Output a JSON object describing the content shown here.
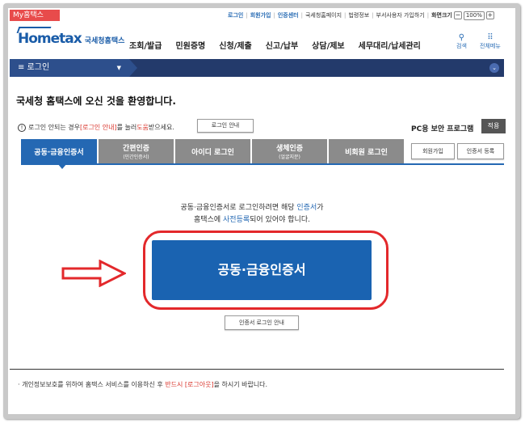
{
  "top": {
    "my_hometax": "My홈택스",
    "links": [
      "로그인",
      "회원가입",
      "인증센터"
    ],
    "links2": [
      "국세청홈페이지",
      "법령정보",
      "부서사용자 가입하기"
    ],
    "zoom_label": "화면크기",
    "zoom_minus": "−",
    "zoom_value": "100%",
    "zoom_plus": "+"
  },
  "header": {
    "logo": "Hometax",
    "logo_sub": "국세청홈택스",
    "nav": [
      "조회/발급",
      "민원증명",
      "신청/제출",
      "신고/납부",
      "상담/제보",
      "세무대리/납세관리"
    ],
    "search_label": "검색",
    "menu_label": "전체메뉴"
  },
  "darkbar": {
    "login_label": "≡  로그인"
  },
  "welcome": "국세청 홈택스에 오신 것을 환영합니다.",
  "notice": {
    "text1": "로그인 안되는 경우 ",
    "red1": "[로그인 안내]",
    "text2": "를 눌러 ",
    "red2": "도움",
    "text3": "받으세요.",
    "button": "로그인 안내"
  },
  "pc_security": {
    "label": "PC용 보안 프로그램",
    "apply": "적용"
  },
  "tabs": [
    {
      "label": "공동·금융인증서",
      "sub": ""
    },
    {
      "label": "간편인증",
      "sub": "(민간인증서)"
    },
    {
      "label": "아이디 로그인",
      "sub": ""
    },
    {
      "label": "생체인증",
      "sub": "(얼굴지문)"
    },
    {
      "label": "비회원 로그인",
      "sub": ""
    }
  ],
  "side_buttons": {
    "signup": "회원가입",
    "cert_register": "인증서 등록"
  },
  "description": {
    "line1a": "공동·금융인증서로 로그인하려면 해당 ",
    "line1b": "인증서",
    "line1c": "가",
    "line2a": "홈택스에 ",
    "line2b": "사전등록",
    "line2c": "되어 있어야 합니다."
  },
  "main_button": "공동·금융인증서",
  "cert_guide_button": "인증서 로그인 안내",
  "footer": {
    "a": "· 개인정보보호를 위하여 홈택스 서비스를 이용하신 후 ",
    "red": "반드시 [로그아웃]",
    "b": "을 하시기 바랍니다."
  },
  "colors": {
    "accent": "#1a63b1",
    "highlight": "#e3282b",
    "navbar": "#233a6b"
  }
}
